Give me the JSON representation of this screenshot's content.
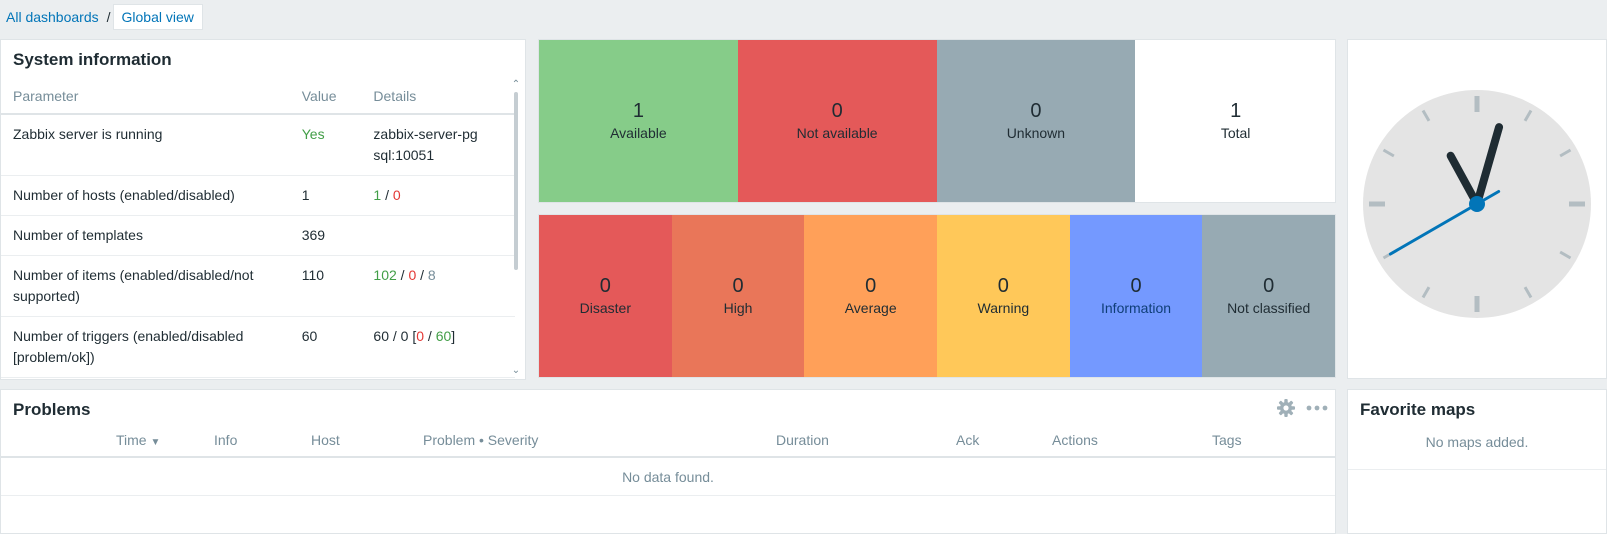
{
  "breadcrumb": {
    "parent": "All dashboards",
    "separator": "/",
    "current": "Global view"
  },
  "system_information": {
    "title": "System information",
    "headers": {
      "parameter": "Parameter",
      "value": "Value",
      "details": "Details"
    },
    "rows": [
      {
        "parameter": "Zabbix server is running",
        "value": "Yes",
        "details": "zabbix-server-pgsql:10051"
      },
      {
        "parameter": "Number of hosts (enabled/disabled)",
        "value": "1",
        "d_enabled": "1",
        "d_sep": " / ",
        "d_disabled": "0"
      },
      {
        "parameter": "Number of templates",
        "value": "369"
      },
      {
        "parameter": "Number of items (enabled/disabled/not supported)",
        "value": "110",
        "d_a": "102",
        "d_b": "0",
        "d_c": "8"
      },
      {
        "parameter": "Number of triggers (enabled/disabled [problem/ok])",
        "value": "60",
        "d_prefix": "60 / 0 [",
        "d_problem": "0",
        "d_ok": "60",
        "d_suffix": "]"
      }
    ]
  },
  "host_availability": [
    {
      "count": "1",
      "label": "Available",
      "color": "#86cc89"
    },
    {
      "count": "0",
      "label": "Not available",
      "color": "#e45959"
    },
    {
      "count": "0",
      "label": "Unknown",
      "color": "#97aab3"
    },
    {
      "count": "1",
      "label": "Total",
      "color": "#ffffff"
    }
  ],
  "problems_by_severity": [
    {
      "count": "0",
      "label": "Disaster",
      "color": "#e45959"
    },
    {
      "count": "0",
      "label": "High",
      "color": "#e97659"
    },
    {
      "count": "0",
      "label": "Average",
      "color": "#ffa059"
    },
    {
      "count": "0",
      "label": "Warning",
      "color": "#ffc859"
    },
    {
      "count": "0",
      "label": "Information",
      "color": "#7499ff"
    },
    {
      "count": "0",
      "label": "Not classified",
      "color": "#97aab3"
    }
  ],
  "clock": {
    "face_color": "#e4e4e4",
    "hand_color": "#1f2c33",
    "second_hand_color": "#0275b8",
    "hour": 11,
    "minute": 2,
    "second": 40
  },
  "problems": {
    "title": "Problems",
    "columns": {
      "time": "Time",
      "sort_arrow": "▼",
      "info": "Info",
      "host": "Host",
      "problem": "Problem • Severity",
      "duration": "Duration",
      "ack": "Ack",
      "actions": "Actions",
      "tags": "Tags"
    },
    "empty_message": "No data found."
  },
  "favorite_maps": {
    "title": "Favorite maps",
    "empty_message": "No maps added."
  }
}
